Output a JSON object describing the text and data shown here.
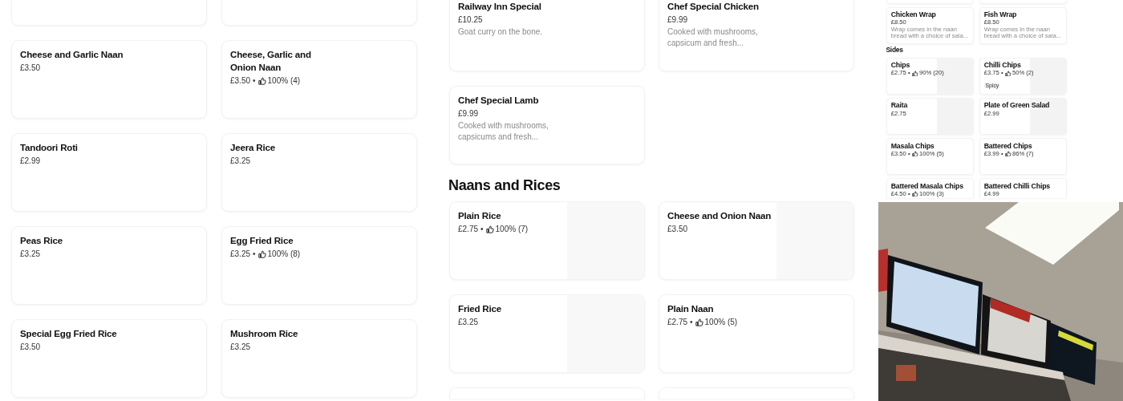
{
  "left_menu": {
    "sections": [
      {
        "items": [
          {
            "kind": "top-cut"
          },
          {
            "kind": "top-cut"
          },
          {
            "kind": "full",
            "name": "Cheese and Garlic Naan",
            "price": "£3.50"
          },
          {
            "kind": "full",
            "name": "Cheese, Garlic and Onion Naan",
            "price": "£3.50",
            "separator": "•",
            "rating": "100% (4)"
          },
          {
            "kind": "full",
            "name": "Tandoori Roti",
            "price": "£2.99"
          },
          {
            "kind": "full",
            "name": "Jeera Rice",
            "price": "£3.25"
          },
          {
            "kind": "full",
            "name": "Peas Rice",
            "price": "£3.25"
          },
          {
            "kind": "full",
            "name": "Egg Fried Rice",
            "price": "£3.25",
            "separator": "•",
            "rating": "100% (8)"
          },
          {
            "kind": "full",
            "name": "Special Egg Fried Rice",
            "price": "£3.50"
          },
          {
            "kind": "full",
            "name": "Mushroom Rice",
            "price": "£3.25"
          }
        ]
      }
    ]
  },
  "middle_menu": {
    "sections": [
      {
        "items": [
          {
            "kind": "top-cut",
            "name": "Railway Inn Special",
            "price": "£10.25",
            "description": "Goat curry on the bone."
          },
          {
            "kind": "top-cut",
            "name": "Chef Special Chicken",
            "price": "£9.99",
            "description": "Cooked with mushrooms, capsicum and fresh..."
          },
          {
            "kind": "full",
            "name": "Chef Special Lamb",
            "price": "£9.99",
            "description": "Cooked with mushrooms, capsicums and fresh..."
          }
        ]
      },
      {
        "heading": "Naans and Rices",
        "items": [
          {
            "kind": "full",
            "name": "Plain Rice",
            "price": "£2.75",
            "separator": "•",
            "rating": "100% (7)",
            "has_image": true
          },
          {
            "kind": "full",
            "name": "Cheese and Onion Naan",
            "price": "£3.50",
            "has_image": true
          },
          {
            "kind": "full",
            "name": "Fried Rice",
            "price": "£3.25",
            "has_image": true
          },
          {
            "kind": "full",
            "name": "Plain Naan",
            "price": "£2.75",
            "separator": "•",
            "rating": "100% (5)"
          },
          {
            "kind": "bottom-cut"
          },
          {
            "kind": "bottom-cut"
          }
        ]
      }
    ]
  },
  "thumbnail_menu": {
    "sections": [
      {
        "items": [
          {
            "kind": "top-cut"
          },
          {
            "kind": "top-cut"
          },
          {
            "kind": "full",
            "name": "Chicken Wrap",
            "price": "£8.50",
            "description": "Wrap comes in the naan bread with a choice of sala..."
          },
          {
            "kind": "full",
            "name": "Fish Wrap",
            "price": "£8.50",
            "description": "Wrap comes in the naan bread with a choice of sala..."
          }
        ]
      },
      {
        "heading": "Sides",
        "items": [
          {
            "kind": "full",
            "name": "Chips",
            "price": "£2.75",
            "separator": "•",
            "rating": "90% (20)",
            "has_image": true
          },
          {
            "kind": "full",
            "name": "Chilli Chips",
            "price": "£3.75",
            "separator": "•",
            "rating": "50% (2)",
            "tag": "Spicy",
            "has_image": true
          },
          {
            "kind": "full",
            "name": "Raita",
            "price": "£2.75",
            "has_image": true
          },
          {
            "kind": "full",
            "name": "Plate of Green Salad",
            "price": "£2.99",
            "has_image": true
          },
          {
            "kind": "full",
            "name": "Masala Chips",
            "price": "£3.50",
            "separator": "•",
            "rating": "100% (5)"
          },
          {
            "kind": "full",
            "name": "Battered Chips",
            "price": "£3.99",
            "separator": "•",
            "rating": "86% (7)"
          },
          {
            "kind": "bottom-cut",
            "name": "Battered Masala Chips",
            "price": "£4.50",
            "separator": "•",
            "rating": "100% (3)"
          },
          {
            "kind": "bottom-cut",
            "name": "Battered Chilli Chips",
            "price": "£4.99"
          }
        ]
      }
    ]
  }
}
